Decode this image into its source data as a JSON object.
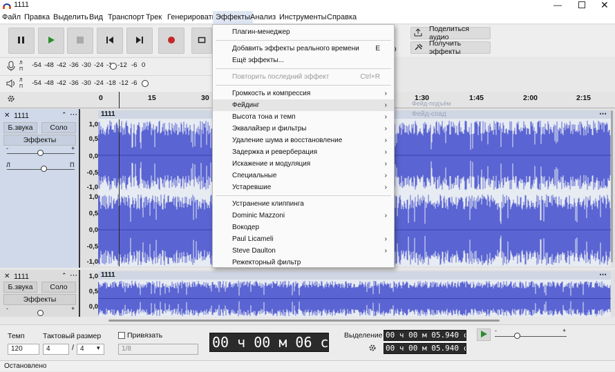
{
  "window": {
    "title": "1111"
  },
  "menubar": {
    "items": [
      "Файл",
      "Правка",
      "Выделить",
      "Вид",
      "Транспорт",
      "Трек",
      "Генерировать",
      "Эффекты",
      "Анализ",
      "Инструменты",
      "Справка"
    ]
  },
  "toolbar": {
    "share_label": "Поделиться аудио",
    "get_effects_label": "Получить эффекты"
  },
  "meters": {
    "ticks": [
      "-54",
      "-48",
      "-42",
      "-36",
      "-30",
      "-24",
      "-18",
      "-12",
      "-6",
      "0"
    ],
    "rec_ticks": [
      "-54",
      "-48",
      "-42",
      "-36",
      "-30",
      "-24",
      "-1",
      "-12",
      "-6",
      "0"
    ],
    "l": "Л",
    "r": "П"
  },
  "ruler": {
    "ticks": [
      "0",
      "15",
      "30",
      "1:30",
      "1:45",
      "2:00",
      "2:15"
    ],
    "fade_in_hint": "Фейд-подъём",
    "fade_out_hint": "Фейд-спад"
  },
  "tracks": [
    {
      "name": "1111",
      "mute": "Б.звука",
      "solo": "Соло",
      "effects": "Эффекты",
      "pan_l": "Л",
      "pan_r": "П",
      "scale": [
        "1,0",
        "0,5",
        "0,0",
        "-0,5",
        "-1,0"
      ]
    },
    {
      "name": "1111",
      "mute": "Б.звука",
      "solo": "Соло",
      "effects": "Эффекты"
    }
  ],
  "effects_menu": {
    "items": [
      {
        "label": "Плагин-менеджер"
      },
      {
        "sep": true
      },
      {
        "label": "Добавить эффекты реального времени",
        "shortcut": "E"
      },
      {
        "label": "Ещё эффекты..."
      },
      {
        "sep": true
      },
      {
        "label": "Повторить последний эффект",
        "shortcut": "Ctrl+R",
        "disabled": true
      },
      {
        "sep": true
      },
      {
        "label": "Громкость и компрессия",
        "submenu": true
      },
      {
        "label": "Фейдинг",
        "submenu": true,
        "highlight": true
      },
      {
        "label": "Высота тона и темп",
        "submenu": true
      },
      {
        "label": "Эквалайзер и фильтры",
        "submenu": true
      },
      {
        "label": "Удаление шума и восстановление",
        "submenu": true
      },
      {
        "label": "Задержка и реверберация",
        "submenu": true
      },
      {
        "label": "Искажение и модуляция",
        "submenu": true
      },
      {
        "label": "Специальные",
        "submenu": true
      },
      {
        "label": "Устаревшие",
        "submenu": true
      },
      {
        "sep": true
      },
      {
        "label": "Устранение клиппинга"
      },
      {
        "label": "Dominic Mazzoni",
        "submenu": true
      },
      {
        "label": "Вокодер"
      },
      {
        "label": "Paul Licameli",
        "submenu": true
      },
      {
        "label": "Steve Daulton",
        "submenu": true
      },
      {
        "label": "Режекторный фильтр"
      }
    ]
  },
  "bottom": {
    "tempo_label": "Темп",
    "tempo_value": "120",
    "time_sig_label": "Тактовый размер",
    "time_sig_num": "4",
    "time_sig_den": "4",
    "slash": "/",
    "snap_label": "Привязать",
    "snap_value": "1/8",
    "time_display": "00 ч 00 м 06 с",
    "selection_label": "Выделение",
    "sel_start": "00 ч 00 м 05.940 с",
    "sel_end": "00 ч 00 м 05.940 с"
  },
  "status": {
    "text": "Остановлено"
  },
  "colors": {
    "waveform": "#5a64d2",
    "record": "#c62828",
    "play": "#2e8b2e"
  },
  "icons": [
    "audacity-logo-icon",
    "minimize-icon",
    "maximize-icon",
    "close-icon",
    "pause-icon",
    "play-icon",
    "stop-icon",
    "skip-start-icon",
    "skip-end-icon",
    "record-icon",
    "loop-icon",
    "microphone-icon",
    "speaker-icon",
    "share-icon",
    "plugin-icon",
    "gear-icon"
  ]
}
